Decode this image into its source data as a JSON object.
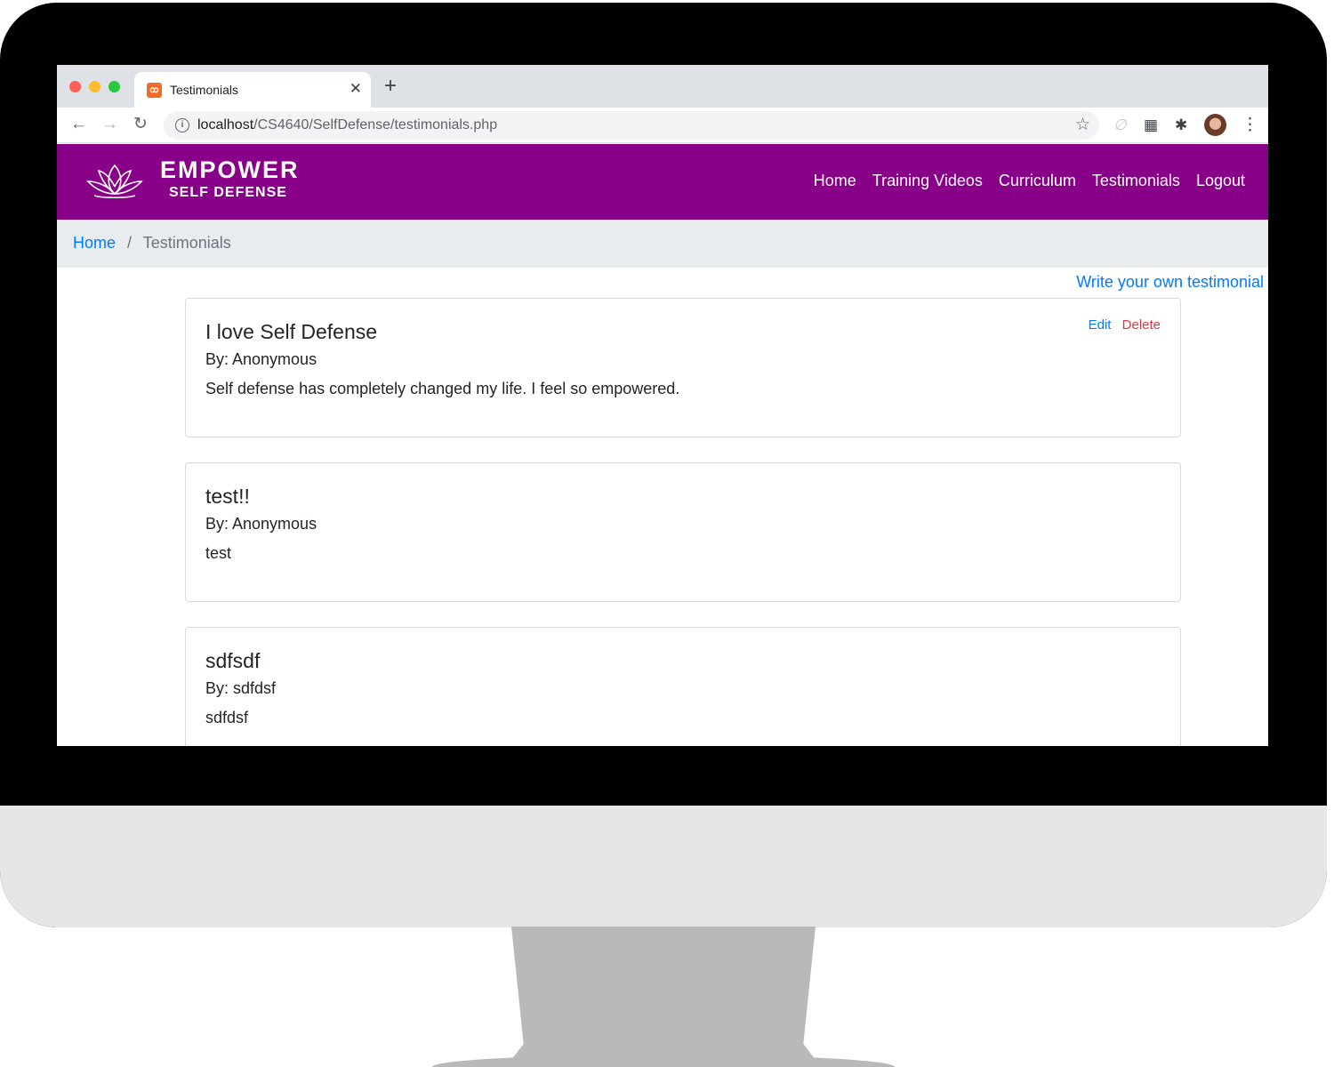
{
  "browser": {
    "tab_title": "Testimonials",
    "tab_favicon": "xampp-icon",
    "url_host": "localhost",
    "url_path": "/CS4640/SelfDefense/testimonials.php"
  },
  "site": {
    "brand_line1": "EMPOWER",
    "brand_line2": "SELF DEFENSE",
    "nav": [
      "Home",
      "Training Videos",
      "Curriculum",
      "Testimonials",
      "Logout"
    ],
    "colors": {
      "header": "#870087",
      "link": "#007bff",
      "delete": "#dc3545"
    }
  },
  "breadcrumb": {
    "home": "Home",
    "separator": "/",
    "current": "Testimonials"
  },
  "write_link": "Write your own testimonial",
  "testimonials": [
    {
      "title": "I love Self Defense",
      "author": "By: Anonymous",
      "body": "Self defense has completely changed my life. I feel so empowered.",
      "edit": "Edit",
      "delete": "Delete"
    },
    {
      "title": "test!!",
      "author": "By: Anonymous",
      "body": "test"
    },
    {
      "title": "sdfsdf",
      "author": "By: sdfdsf",
      "body": "sdfdsf"
    }
  ]
}
